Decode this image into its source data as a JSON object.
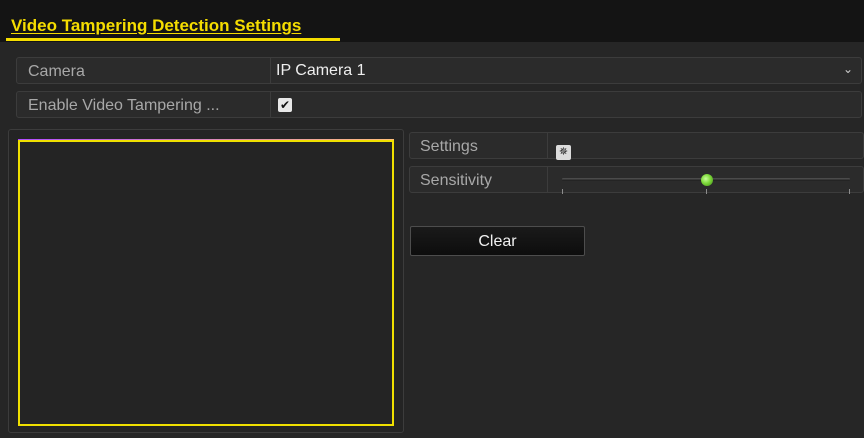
{
  "header": {
    "title": "Video Tampering Detection Settings"
  },
  "camera": {
    "label": "Camera",
    "value": "IP Camera 1",
    "dropdown_icon": "chevron-down-icon"
  },
  "enable": {
    "label": "Enable Video Tampering ...",
    "checked": true,
    "check_glyph": "✔"
  },
  "settings": {
    "label": "Settings",
    "icon": "gear-icon",
    "icon_glyph": "✵"
  },
  "sensitivity": {
    "label": "Sensitivity",
    "level_fraction": 0.5,
    "ticks": 3
  },
  "actions": {
    "clear_label": "Clear"
  },
  "colors": {
    "title": "#f5dd00",
    "tamper_area_border": "#f0e000",
    "slider_knob": "#7dd83a",
    "background": "#262626"
  }
}
